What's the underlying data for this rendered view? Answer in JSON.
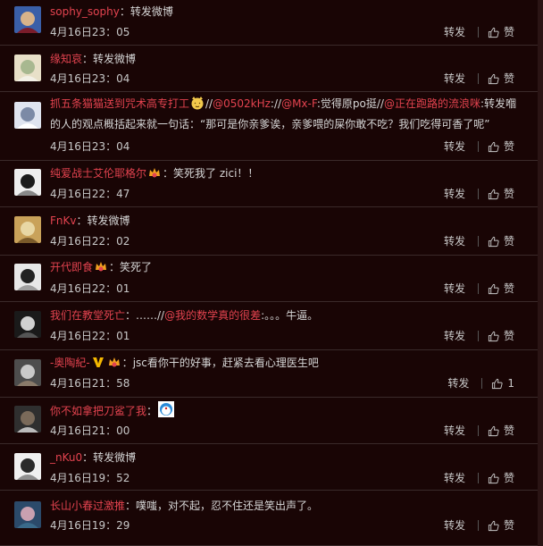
{
  "labels": {
    "repost": "转发",
    "like": "赞",
    "like_count_12": "1"
  },
  "comments": [
    {
      "user": "sophy_sophy",
      "sep": "：",
      "text": "转发微博",
      "time": "4月16日23：05"
    },
    {
      "user": "缘知哀",
      "sep": "：",
      "text": "转发微博",
      "time": "4月16日23：04"
    },
    {
      "user": "抓五条猫猫送到咒术高专打工",
      "m1": "@0502kHz",
      "m2": "@Mx-F",
      "t1": ":觉得原po挺",
      "t2": "//",
      "m3": "@正在跑路的流浪咪",
      "text": ":转发嗰的人的观点概括起来就一句话：“那可是你亲爹诶，亲爹喂的屎你敢不吃？我们吃得可香了呢”",
      "time": "4月16日23：04"
    },
    {
      "user": "纯爱战士艾伦耶格尔",
      "sep": "：",
      "text": "笑死我了 zici！！",
      "time": "4月16日22：47"
    },
    {
      "user": "FnKv",
      "sep": "：",
      "text": "转发微博",
      "time": "4月16日22：02"
    },
    {
      "user": "开代即食",
      "sep": "：",
      "text": "笑死了",
      "time": "4月16日22：01"
    },
    {
      "user": "我们在教堂死亡",
      "sep": "：……//",
      "mention": "@我的数学真的很差",
      "text": ":。。。牛逼。",
      "time": "4月16日22：01"
    },
    {
      "user": "-奥陶紀-",
      "sep": "：",
      "text": "jsc看你干的好事，赶紧去看心理医生吧",
      "time": "4月16日21：58",
      "likes": "1"
    },
    {
      "user": "你不如拿把刀鲨了我",
      "sep": "：",
      "text": "",
      "time": "4月16日21：00"
    },
    {
      "user": "_nKu0",
      "sep": "：",
      "text": "转发微博",
      "time": "4月16日19：52"
    },
    {
      "user": "长山小春过激推",
      "sep": "：",
      "text": "噗嗤，对不起，忍不住还是笑出声了。",
      "time": "4月16日19：29"
    }
  ],
  "colors": {
    "background": "#190505",
    "username": "#e3434f",
    "text": "#d6d6d6",
    "meta": "#c8c8c8",
    "divider": "#3a2a2a"
  },
  "icons": {
    "like": "thumbs-up-icon",
    "emoji": "cat-emoji-icon",
    "badge": "member-badge-icon",
    "verified": "verified-v-icon",
    "sticker": "doraemon-sticker-icon"
  }
}
